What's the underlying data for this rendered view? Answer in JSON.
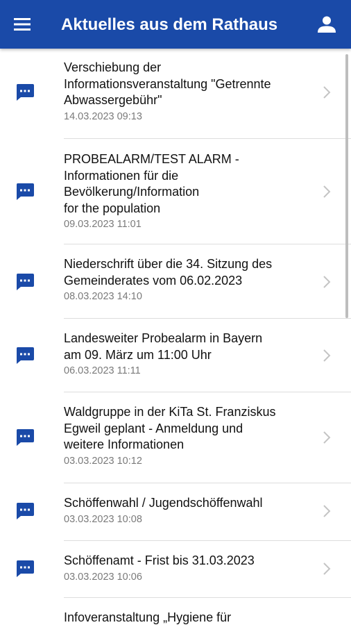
{
  "header": {
    "title": "Aktuelles aus dem Rathaus",
    "menu_icon": "hamburger-menu-icon",
    "profile_icon": "person-icon"
  },
  "colors": {
    "primary": "#1a4aa8",
    "text": "#111111",
    "date": "#7a7a7a",
    "divider": "#dddddd"
  },
  "news": [
    {
      "title": "Verschiebung der\nInformationsveranstaltung \"Getrennte\nAbwassergebühr\"",
      "date": "14.03.2023 09:13"
    },
    {
      "title": "PROBEALARM/TEST ALARM -\nInformationen für die\nBevölkerung/Information\nfor the population",
      "date": "09.03.2023 11:01"
    },
    {
      "title": "Niederschrift über die 34. Sitzung des\nGemeinderates vom 06.02.2023",
      "date": "08.03.2023 14:10"
    },
    {
      "title": "Landesweiter Probealarm in Bayern\nam 09. März um 11:00 Uhr",
      "date": "06.03.2023 11:11"
    },
    {
      "title": "Waldgruppe in der KiTa St. Franziskus\nEgweil geplant - Anmeldung und\nweitere Informationen",
      "date": "03.03.2023 10:12"
    },
    {
      "title": "Schöffenwahl / Jugendschöffenwahl",
      "date": "03.03.2023 10:08"
    },
    {
      "title": "Schöffenamt - Frist bis 31.03.2023",
      "date": "03.03.2023 10:06"
    },
    {
      "title": "Infoveranstaltung „Hygiene für",
      "date": ""
    }
  ]
}
